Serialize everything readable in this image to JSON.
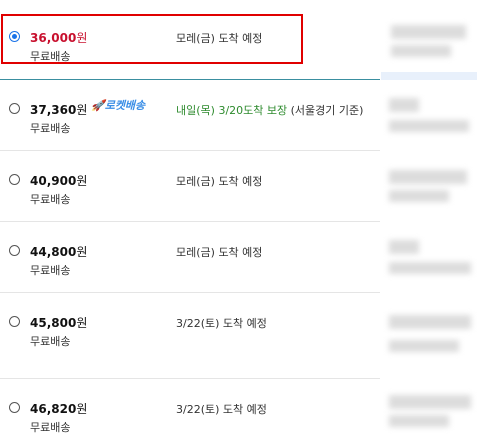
{
  "options": [
    {
      "price": "36,000",
      "won": "원",
      "shipping": "무료배송",
      "eta": "모레(금) 도착 예정",
      "selected": true
    },
    {
      "price": "37,360",
      "won": "원",
      "shipping": "무료배송",
      "badge": "🚀로켓배송",
      "eta_green": "내일(목) 3/20도착 보장",
      "eta_suffix": " (서울경기 기준)"
    },
    {
      "price": "40,900",
      "won": "원",
      "shipping": "무료배송",
      "eta": "모레(금) 도착 예정"
    },
    {
      "price": "44,800",
      "won": "원",
      "shipping": "무료배송",
      "eta": "모레(금) 도착 예정"
    },
    {
      "price": "45,800",
      "won": "원",
      "shipping": "무료배송",
      "eta": "3/22(토) 도착 예정"
    },
    {
      "price": "46,820",
      "won": "원",
      "shipping": "무료배송",
      "eta": "3/22(토) 도착 예정"
    }
  ],
  "colors": {
    "selected_price": "#c8102e",
    "rocket": "#3a8ee6",
    "guarantee": "#2e8b2e",
    "highlight_border": "#e00000"
  }
}
